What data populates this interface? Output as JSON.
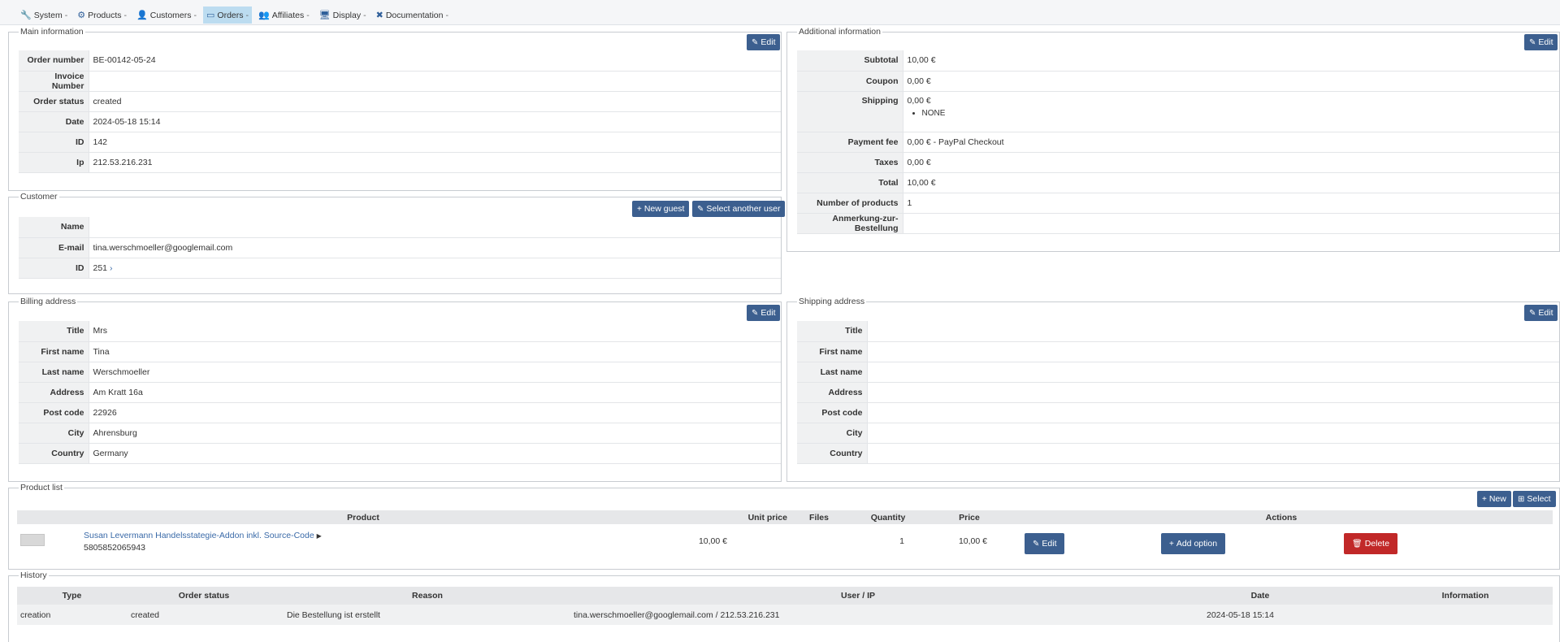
{
  "nav": [
    {
      "icon": "wrench-icon",
      "glyph": "🔧",
      "label": "System",
      "active": false
    },
    {
      "icon": "products-icon",
      "glyph": "⚙",
      "label": "Products",
      "active": false
    },
    {
      "icon": "user-icon",
      "glyph": "👤",
      "label": "Customers",
      "active": false
    },
    {
      "icon": "credit-card-icon",
      "glyph": "▭",
      "label": "Orders",
      "active": true
    },
    {
      "icon": "users-icon",
      "glyph": "👥",
      "label": "Affiliates",
      "active": false
    },
    {
      "icon": "monitor-icon",
      "glyph": "🖥",
      "label": "Display",
      "active": false
    },
    {
      "icon": "help-circle-icon",
      "glyph": "✖",
      "label": "Documentation",
      "active": false
    }
  ],
  "main_info": {
    "legend": "Main information",
    "edit_label": "Edit",
    "rows": [
      {
        "label": "Order number",
        "value": "BE-00142-05-24"
      },
      {
        "label": "Invoice Number",
        "value": ""
      },
      {
        "label": "Order status",
        "value": "created"
      },
      {
        "label": "Date",
        "value": "2024-05-18 15:14"
      },
      {
        "label": "ID",
        "value": "142"
      },
      {
        "label": "Ip",
        "value": "212.53.216.231"
      }
    ]
  },
  "additional_info": {
    "legend": "Additional information",
    "edit_label": "Edit",
    "subtotal_label": "Subtotal",
    "subtotal": "10,00 €",
    "coupon_label": "Coupon",
    "coupon": "0,00 €",
    "shipping_label": "Shipping",
    "shipping": "0,00 €",
    "shipping_method": "NONE",
    "payment_fee_label": "Payment fee",
    "payment_fee": "0,00 € - PayPal Checkout",
    "taxes_label": "Taxes",
    "taxes": "0,00 €",
    "total_label": "Total",
    "total": "10,00 €",
    "num_products_label": "Number of products",
    "num_products": "1",
    "note_label": "Anmerkung-zur-Bestellung",
    "note": ""
  },
  "customer": {
    "legend": "Customer",
    "new_guest_label": "New guest",
    "select_user_label": "Select another user",
    "name_label": "Name",
    "name": "",
    "email_label": "E-mail",
    "email": "tina.werschmoeller@googlemail.com",
    "id_label": "ID",
    "id": "251"
  },
  "billing": {
    "legend": "Billing address",
    "edit_label": "Edit",
    "rows": [
      {
        "label": "Title",
        "value": "Mrs"
      },
      {
        "label": "First name",
        "value": "Tina"
      },
      {
        "label": "Last name",
        "value": "Werschmoeller"
      },
      {
        "label": "Address",
        "value": "Am Kratt 16a"
      },
      {
        "label": "Post code",
        "value": "22926"
      },
      {
        "label": "City",
        "value": "Ahrensburg"
      },
      {
        "label": "Country",
        "value": "Germany"
      }
    ]
  },
  "shipping_addr": {
    "legend": "Shipping address",
    "edit_label": "Edit",
    "rows": [
      {
        "label": "Title",
        "value": ""
      },
      {
        "label": "First name",
        "value": ""
      },
      {
        "label": "Last name",
        "value": ""
      },
      {
        "label": "Address",
        "value": ""
      },
      {
        "label": "Post code",
        "value": ""
      },
      {
        "label": "City",
        "value": ""
      },
      {
        "label": "Country",
        "value": ""
      }
    ]
  },
  "products": {
    "legend": "Product list",
    "new_label": "New",
    "select_label": "Select",
    "headers": {
      "product": "Product",
      "unit_price": "Unit price",
      "files": "Files",
      "quantity": "Quantity",
      "price": "Price",
      "actions": "Actions"
    },
    "item": {
      "name": "Susan Levermann Handelsstategie-Addon inkl. Source-Code",
      "sku": "5805852065943",
      "unit_price": "10,00 €",
      "files": "",
      "quantity": "1",
      "price": "10,00 €",
      "edit_label": "Edit",
      "add_option_label": "Add option",
      "delete_label": "Delete"
    }
  },
  "history": {
    "legend": "History",
    "headers": {
      "type": "Type",
      "status": "Order status",
      "reason": "Reason",
      "user": "User / IP",
      "date": "Date",
      "info": "Information"
    },
    "row": {
      "type": "creation",
      "status": "created",
      "reason": "Die Bestellung ist erstellt",
      "user": "tina.werschmoeller@googlemail.com / 212.53.216.231",
      "date": "2024-05-18 15:14",
      "info": ""
    }
  }
}
